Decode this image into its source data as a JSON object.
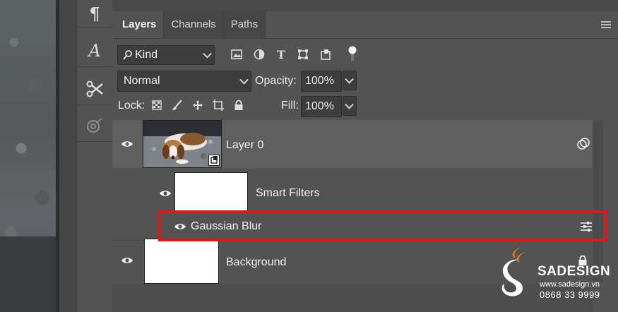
{
  "tools": [
    {
      "name": "paragraph-icon",
      "glyph": "¶"
    },
    {
      "name": "character-icon",
      "glyph": "A"
    },
    {
      "name": "tool-presets-icon"
    },
    {
      "name": "clone-source-icon"
    }
  ],
  "panel": {
    "tabs": [
      {
        "label": "Layers",
        "active": true
      },
      {
        "label": "Channels",
        "active": false
      },
      {
        "label": "Paths",
        "active": false
      }
    ],
    "filter_kind": "Kind",
    "blend_mode": "Normal",
    "opacity_label": "Opacity:",
    "opacity_value": "100%",
    "lock_label": "Lock:",
    "fill_label": "Fill:",
    "fill_value": "100%"
  },
  "layers": [
    {
      "name": "Layer 0",
      "visible": true,
      "selected": true,
      "smart_object": true
    },
    {
      "name": "Smart Filters",
      "visible": true
    },
    {
      "name": "Gaussian Blur",
      "visible": true
    },
    {
      "name": "Background",
      "visible": true,
      "locked": true
    }
  ],
  "watermark": {
    "brand": "SADESIGN",
    "site": "www.sadesign.vn",
    "phone": "0868 33 9999",
    "accent": "#f07a1a"
  },
  "colors": {
    "highlight": "#e01717",
    "panel": "#535353",
    "selected_row": "#5f5f5f"
  }
}
